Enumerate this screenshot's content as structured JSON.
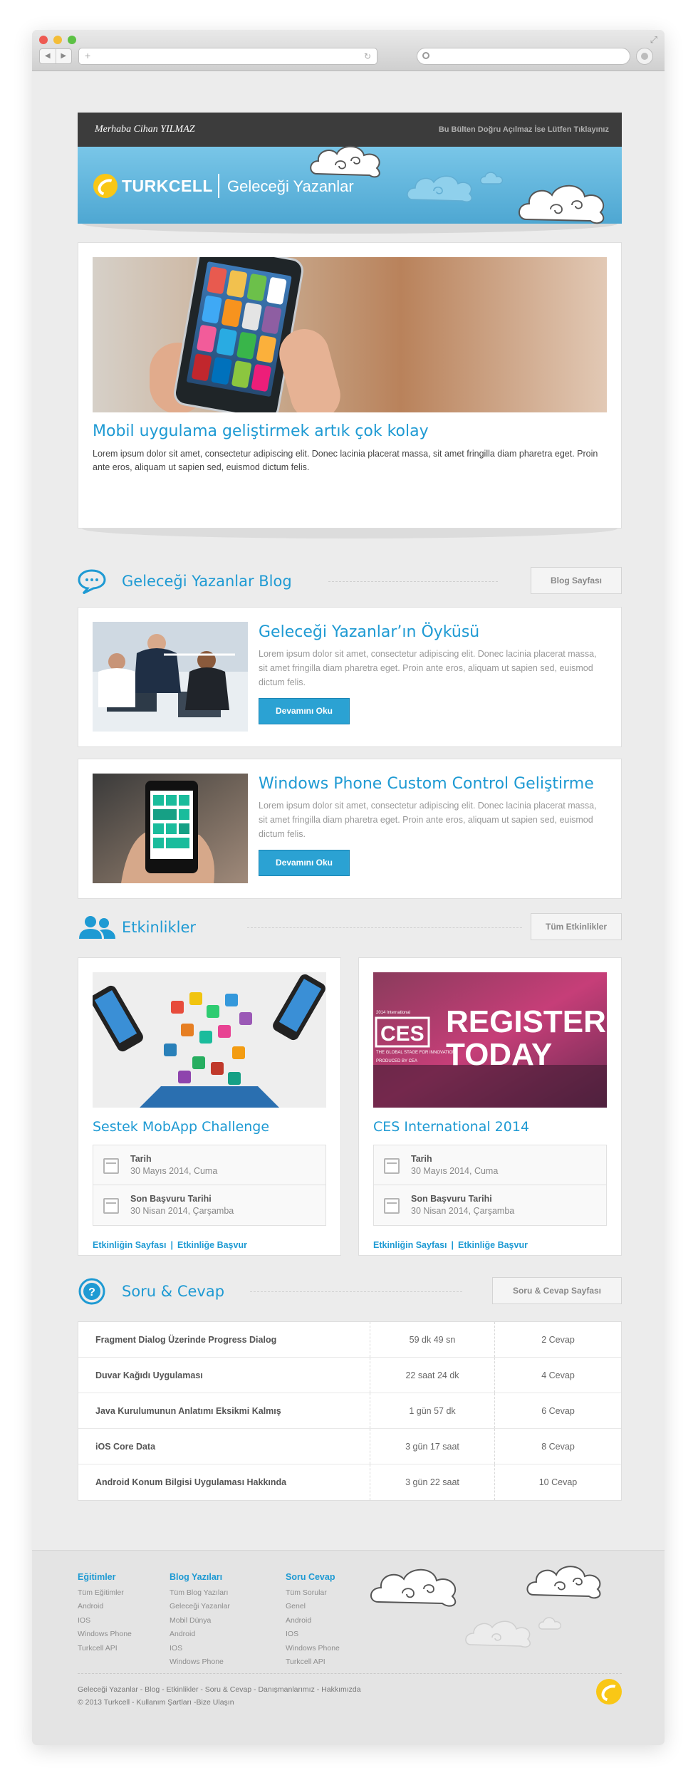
{
  "header": {
    "greeting": "Merhaba Cihan YILMAZ",
    "view_online_link": "Bu Bülten Doğru Açılmaz İse Lütfen Tıklayınız",
    "brand": "TURKCELL",
    "tagline": "Geleceği Yazanlar"
  },
  "hero": {
    "title": "Mobil uygulama geliştirmek artık çok kolay",
    "text": "Lorem ipsum dolor sit amet, consectetur adipiscing elit. Donec lacinia placerat massa, sit amet fringilla diam pharetra eget. Proin ante eros, aliquam ut sapien sed, euismod dictum felis."
  },
  "blog": {
    "title": "Geleceği Yazanlar Blog",
    "button": "Blog Sayfası",
    "posts": [
      {
        "title": "Geleceği Yazanlar’ın Öyküsü",
        "text": "Lorem ipsum dolor sit amet, consectetur adipiscing elit. Donec lacinia placerat massa, sit amet fringilla diam pharetra eget. Proin ante eros, aliquam ut sapien sed, euismod dictum felis.",
        "button": "Devamını Oku"
      },
      {
        "title": "Windows Phone Custom Control Geliştirme",
        "text": "Lorem ipsum dolor sit amet, consectetur adipiscing elit. Donec lacinia placerat massa, sit amet fringilla diam pharetra eget. Proin ante eros, aliquam ut sapien sed, euismod dictum felis.",
        "button": "Devamını Oku"
      }
    ]
  },
  "events": {
    "title": "Etkinlikler",
    "button": "Tüm Etkinlikler",
    "items": [
      {
        "title": "Sestek MobApp Challenge",
        "date_label": "Tarih",
        "date": "30 Mayıs 2014, Cuma",
        "deadline_label": "Son Başvuru Tarihi",
        "deadline": "30 Nisan 2014, Çarşamba",
        "link1": "Etkinliğin Sayfası",
        "separator": "|",
        "link2": "Etkinliğe Başvur"
      },
      {
        "title": "CES International 2014",
        "image_text_brand": "CES",
        "image_text_1": "REGISTER",
        "image_text_2": "TODAY",
        "image_text_3": "2014 International",
        "image_text_4": "THE GLOBAL STAGE FOR INNOVATION",
        "image_text_5": "PRODUCED BY CEA",
        "date_label": "Tarih",
        "date": "30 Mayıs 2014, Cuma",
        "deadline_label": "Son Başvuru Tarihi",
        "deadline": "30 Nisan 2014, Çarşamba",
        "link1": "Etkinliğin Sayfası",
        "separator": "|",
        "link2": "Etkinliğe Başvur"
      }
    ]
  },
  "qa": {
    "title": "Soru & Cevap",
    "button": "Soru & Cevap Sayfası",
    "rows": [
      {
        "question": "Fragment Dialog Üzerinde Progress Dialog",
        "time": "59 dk 49 sn",
        "answers": "2 Cevap"
      },
      {
        "question": "Duvar Kağıdı Uygulaması",
        "time": "22 saat 24 dk",
        "answers": "4 Cevap"
      },
      {
        "question": "Java Kurulumunun Anlatımı Eksikmi Kalmış",
        "time": "1 gün 57 dk",
        "answers": "6 Cevap"
      },
      {
        "question": "iOS Core Data",
        "time": "3 gün 17 saat",
        "answers": "8 Cevap"
      },
      {
        "question": "Android Konum Bilgisi Uygulaması Hakkında",
        "time": "3 gün 22 saat",
        "answers": "10 Cevap"
      }
    ]
  },
  "footer": {
    "columns": [
      {
        "title": "Eğitimler",
        "items": [
          "Tüm Eğitimler",
          "Android",
          "IOS",
          "Windows Phone",
          "Turkcell API"
        ]
      },
      {
        "title": "Blog Yazıları",
        "items": [
          "Tüm Blog Yazıları",
          "Geleceği Yazanlar",
          "Mobil Dünya",
          "Android",
          "IOS",
          "Windows Phone"
        ]
      },
      {
        "title": "Soru Cevap",
        "items": [
          "Tüm Sorular",
          "Genel",
          "Android",
          "IOS",
          "Windows Phone",
          "Turkcell API"
        ]
      }
    ],
    "links_line": "Geleceği Yazanlar - Blog - Etkinlikler - Soru & Cevap - Danışmanlarımız - Hakkımızda",
    "copyright_line": "© 2013 Turkcell - Kullanım Şartları -Bize Ulaşın"
  },
  "colors": {
    "accent": "#1e9ad3",
    "button": "#2ba2d3",
    "header_dark": "#3c3c3c",
    "header_blue": "#5db3da",
    "brand_yellow": "#f9c716"
  }
}
